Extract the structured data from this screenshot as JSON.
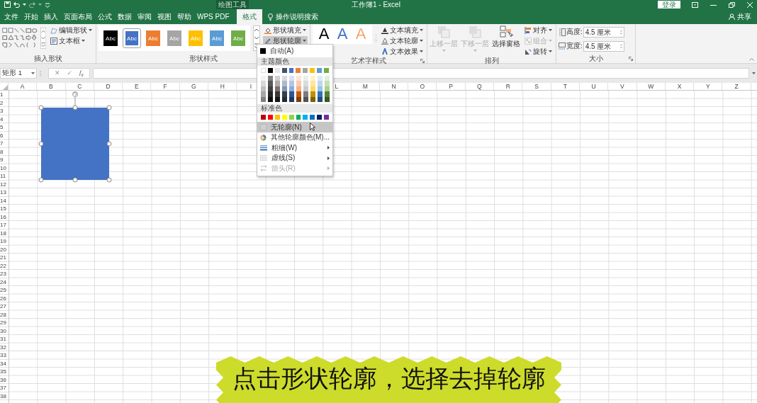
{
  "title_bar": {
    "context_label": "绘图工具",
    "title": "工作簿1 - Excel",
    "sign_in": "登录"
  },
  "tabs": [
    {
      "label": "文件",
      "selected": false
    },
    {
      "label": "开始",
      "selected": false
    },
    {
      "label": "插入",
      "selected": false
    },
    {
      "label": "页面布局",
      "selected": false
    },
    {
      "label": "公式",
      "selected": false
    },
    {
      "label": "数据",
      "selected": false
    },
    {
      "label": "审阅",
      "selected": false
    },
    {
      "label": "视图",
      "selected": false
    },
    {
      "label": "帮助",
      "selected": false
    },
    {
      "label": "WPS PDF",
      "selected": false
    },
    {
      "label": "格式",
      "selected": true
    }
  ],
  "tell_me": "操作说明搜索",
  "share": "共享",
  "insert_shapes": {
    "label": "插入形状",
    "buttons": [
      "编辑形状",
      "文本框"
    ]
  },
  "shape_styles": {
    "label": "形状样式",
    "styles": [
      {
        "text": "Abc",
        "color": "#000000",
        "selected": false
      },
      {
        "text": "Abc",
        "color": "#4472c4",
        "selected": true
      },
      {
        "text": "Abc",
        "color": "#ed7d31",
        "selected": false
      },
      {
        "text": "Abc",
        "color": "#a5a5a5",
        "selected": false
      },
      {
        "text": "Abc",
        "color": "#ffc000",
        "selected": false
      },
      {
        "text": "Abc",
        "color": "#5b9bd5",
        "selected": false
      },
      {
        "text": "Abc",
        "color": "#70ad47",
        "selected": false
      }
    ],
    "buttons": [
      {
        "label": "形状填充",
        "pressed": false
      },
      {
        "label": "形状轮廓",
        "pressed": true
      }
    ]
  },
  "wordart_styles": {
    "label": "艺术字样式",
    "samples": [
      {
        "text": "A",
        "kind": "solid",
        "color": "#000000"
      },
      {
        "text": "A",
        "kind": "solid",
        "color": "#4472c4"
      },
      {
        "text": "A",
        "kind": "outline",
        "color": "#ed7d31"
      }
    ],
    "buttons": [
      "文本填充",
      "文本轮廓",
      "文本效果"
    ]
  },
  "arrange": {
    "label": "排列",
    "large_buttons": [
      {
        "label": "上移一层",
        "disabled": true
      },
      {
        "label": "下移一层",
        "disabled": true
      },
      {
        "label": "选择窗格",
        "disabled": false
      }
    ],
    "small_buttons": [
      {
        "label": "对齐",
        "disabled": false
      },
      {
        "label": "组合",
        "disabled": true
      },
      {
        "label": "旋转",
        "disabled": false
      }
    ]
  },
  "size": {
    "label": "大小",
    "fields": [
      {
        "label": "高度:",
        "value": "4.5 厘米"
      },
      {
        "label": "宽度:",
        "value": "4.5 厘米"
      }
    ]
  },
  "formula_bar": {
    "name_box": "矩形 1",
    "cancel": "✕",
    "enter": "✓",
    "function": "f$_{x}$"
  },
  "sheet": {
    "columns_left": [
      "A",
      "B",
      "C",
      "D",
      "E",
      "F",
      "G",
      "H",
      "I"
    ],
    "columns_right": [
      "L",
      "M",
      "N",
      "O",
      "P",
      "Q",
      "R",
      "S",
      "T",
      "U",
      "V",
      "W",
      "X",
      "Y",
      "Z"
    ],
    "rows": [
      "1",
      "2",
      "3",
      "4",
      "5",
      "6",
      "7",
      "8",
      "9",
      "10",
      "11",
      "12",
      "13",
      "14",
      "15",
      "16",
      "17",
      "18",
      "19",
      "20",
      "21",
      "22",
      "23",
      "24",
      "25",
      "26",
      "27",
      "28",
      "29",
      "30",
      "31",
      "32",
      "33",
      "34",
      "35",
      "36",
      "37",
      "38"
    ]
  },
  "shape": {
    "selected": true
  },
  "outline_menu": {
    "auto": "自动(A)",
    "theme_header": "主题颜色",
    "theme_colors": [
      {
        "color": "#ffffff",
        "shades": [
          {
            "color": "#f2f2f2"
          },
          {
            "color": "#d9d9d9"
          },
          {
            "color": "#bfbfbf"
          },
          {
            "color": "#a6a6a6"
          },
          {
            "color": "#808080"
          }
        ]
      },
      {
        "color": "#000000",
        "shades": [
          {
            "color": "#808080"
          },
          {
            "color": "#595959"
          },
          {
            "color": "#404040"
          },
          {
            "color": "#262626"
          },
          {
            "color": "#0d0d0d"
          }
        ]
      },
      {
        "color": "#e7e6e6",
        "shades": [
          {
            "color": "#d0cece"
          },
          {
            "color": "#aeaaaa"
          },
          {
            "color": "#757171"
          },
          {
            "color": "#3a3838"
          },
          {
            "color": "#171616"
          }
        ]
      },
      {
        "color": "#44546a",
        "shades": [
          {
            "color": "#d6dce4"
          },
          {
            "color": "#adb9ca"
          },
          {
            "color": "#8497b0"
          },
          {
            "color": "#333f4f"
          },
          {
            "color": "#222a35"
          }
        ]
      },
      {
        "color": "#4472c4",
        "shades": [
          {
            "color": "#d9e2f3"
          },
          {
            "color": "#b4c6e7"
          },
          {
            "color": "#8eaadb"
          },
          {
            "color": "#2f5496"
          },
          {
            "color": "#1f3864"
          }
        ]
      },
      {
        "color": "#ed7d31",
        "shades": [
          {
            "color": "#fbe5d5"
          },
          {
            "color": "#f7cbac"
          },
          {
            "color": "#f4b183"
          },
          {
            "color": "#c55a11"
          },
          {
            "color": "#833c0b"
          }
        ]
      },
      {
        "color": "#a5a5a5",
        "shades": [
          {
            "color": "#ededed"
          },
          {
            "color": "#dbdbdb"
          },
          {
            "color": "#c9c9c9"
          },
          {
            "color": "#7b7b7b"
          },
          {
            "color": "#525252"
          }
        ]
      },
      {
        "color": "#ffc000",
        "shades": [
          {
            "color": "#fff2cc"
          },
          {
            "color": "#fee599"
          },
          {
            "color": "#ffd966"
          },
          {
            "color": "#bf9000"
          },
          {
            "color": "#7f6000"
          }
        ]
      },
      {
        "color": "#5b9bd5",
        "shades": [
          {
            "color": "#deebf6"
          },
          {
            "color": "#bdd7ee"
          },
          {
            "color": "#9dc3e6"
          },
          {
            "color": "#2e75b5"
          },
          {
            "color": "#1e4e79"
          }
        ]
      },
      {
        "color": "#70ad47",
        "shades": [
          {
            "color": "#e2efd9"
          },
          {
            "color": "#c5e0b3"
          },
          {
            "color": "#a8d08d"
          },
          {
            "color": "#538135"
          },
          {
            "color": "#375623"
          }
        ]
      }
    ],
    "standard_header": "标准色",
    "standard_colors": [
      {
        "color": "#c00000"
      },
      {
        "color": "#ff0000"
      },
      {
        "color": "#ffc000"
      },
      {
        "color": "#ffff00"
      },
      {
        "color": "#92d050"
      },
      {
        "color": "#00b050"
      },
      {
        "color": "#00b0f0"
      },
      {
        "color": "#0070c0"
      },
      {
        "color": "#002060"
      },
      {
        "color": "#7030a0"
      }
    ],
    "items": [
      {
        "label": "无轮廓(N)",
        "kind": "none",
        "highlighted": true,
        "submenu": false,
        "disabled": false
      },
      {
        "label": "其他轮廓颜色(M)...",
        "kind": "more",
        "highlighted": false,
        "submenu": false,
        "disabled": false
      },
      {
        "label": "粗细(W)",
        "kind": "weight",
        "highlighted": false,
        "submenu": true,
        "disabled": false
      },
      {
        "label": "虚线(S)",
        "kind": "dashes",
        "highlighted": false,
        "submenu": true,
        "disabled": false
      },
      {
        "label": "箭头(R)",
        "kind": "arrows",
        "highlighted": false,
        "submenu": true,
        "disabled": true
      }
    ]
  },
  "caption": "点击形状轮廓，选择去掉轮廓"
}
